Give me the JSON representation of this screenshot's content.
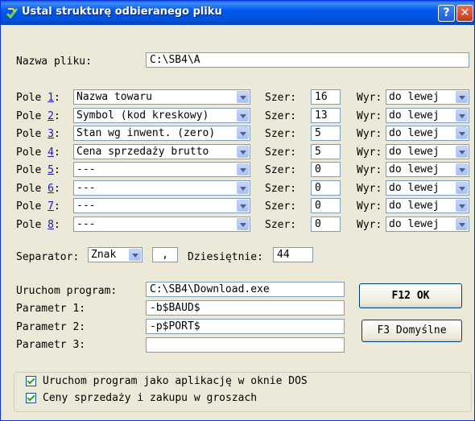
{
  "window": {
    "title": "Ustal strukturę odbieranego pliku",
    "help_label": "?",
    "close_label": "✕"
  },
  "file_name": {
    "label": "Nazwa pliku:",
    "value": "C:\\SB4\\A"
  },
  "fields": [
    {
      "label": "Pole",
      "num": "1",
      "name": "Nazwa towaru",
      "width_label": "Szer:",
      "width": "16",
      "align_label": "Wyr:",
      "align": "do lewej"
    },
    {
      "label": "Pole",
      "num": "2",
      "name": "Symbol (kod kreskowy)",
      "width_label": "Szer:",
      "width": "13",
      "align_label": "Wyr:",
      "align": "do lewej"
    },
    {
      "label": "Pole",
      "num": "3",
      "name": "Stan wg inwent. (zero)",
      "width_label": "Szer:",
      "width": "5",
      "align_label": "Wyr:",
      "align": "do lewej"
    },
    {
      "label": "Pole",
      "num": "4",
      "name": "Cena sprzedaży brutto",
      "width_label": "Szer:",
      "width": "5",
      "align_label": "Wyr:",
      "align": "do lewej"
    },
    {
      "label": "Pole",
      "num": "5",
      "name": "---",
      "width_label": "Szer:",
      "width": "0",
      "align_label": "Wyr:",
      "align": "do lewej"
    },
    {
      "label": "Pole",
      "num": "6",
      "name": "---",
      "width_label": "Szer:",
      "width": "0",
      "align_label": "Wyr:",
      "align": "do lewej"
    },
    {
      "label": "Pole",
      "num": "7",
      "name": "---",
      "width_label": "Szer:",
      "width": "0",
      "align_label": "Wyr:",
      "align": "do lewej"
    },
    {
      "label": "Pole",
      "num": "8",
      "name": "---",
      "width_label": "Szer:",
      "width": "0",
      "align_label": "Wyr:",
      "align": "do lewej"
    }
  ],
  "separator": {
    "label": "Separator:",
    "type": "Znak",
    "char": ",",
    "decimal_label": "Dziesiętnie:",
    "decimal": "44"
  },
  "program": {
    "run_label": "Uruchom program:",
    "run_value": "C:\\SB4\\Download.exe",
    "param1_label": "Parametr 1:",
    "param1_value": "-b$BAUD$",
    "param2_label": "Parametr 2:",
    "param2_value": "-p$PORT$",
    "param3_label": "Parametr 3:",
    "param3_value": ""
  },
  "buttons": {
    "ok": "F12 OK",
    "defaults": "F3 Domyślne"
  },
  "options": [
    {
      "label": "Uruchom program jako aplikację w oknie DOS",
      "checked": true
    },
    {
      "label": "Ceny sprzedaży i zakupu w groszach",
      "checked": true
    }
  ],
  "colors": {
    "titlebar": "#0058ee",
    "accent": "#1a1ab0",
    "check": "#21a121"
  }
}
